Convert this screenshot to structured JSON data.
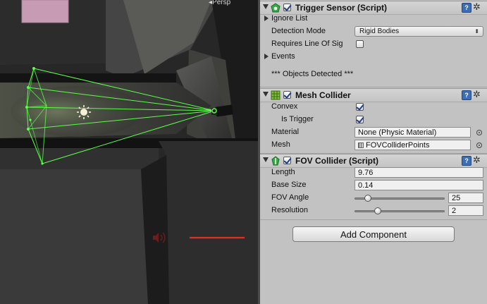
{
  "scene": {
    "camera_mode": "Persp"
  },
  "inspector": {
    "trigger_sensor": {
      "title": "Trigger Sensor (Script)",
      "ignore_list_label": "Ignore List",
      "detection_mode_label": "Detection Mode",
      "detection_mode_value": "Rigid Bodies",
      "requires_los_label": "Requires Line Of Sig",
      "requires_los_checked": false,
      "events_label": "Events",
      "objects_detected_label": "*** Objects Detected ***"
    },
    "mesh_collider": {
      "title": "Mesh Collider",
      "convex_label": "Convex",
      "convex_checked": true,
      "is_trigger_label": "Is Trigger",
      "is_trigger_checked": true,
      "material_label": "Material",
      "material_value": "None (Physic Material)",
      "mesh_label": "Mesh",
      "mesh_value": "FOVColliderPoints"
    },
    "fov_collider": {
      "title": "FOV Collider (Script)",
      "length_label": "Length",
      "length_value": "9.76",
      "base_size_label": "Base Size",
      "base_size_value": "0.14",
      "fov_angle_label": "FOV Angle",
      "fov_angle_value": "25",
      "resolution_label": "Resolution",
      "resolution_value": "2"
    },
    "add_component_label": "Add Component"
  },
  "colors": {
    "inspector_bg": "#c2c2c2",
    "header_bg": "#c8c8c8",
    "gizmo_green": "#5cff4a",
    "accent_blue": "#3d6db4"
  },
  "icons": {
    "trigger_sensor": "script-sensor-icon",
    "mesh_collider": "mesh-collider-icon",
    "fov_collider": "fov-collider-icon",
    "help": "help-book-icon",
    "settings": "gear-icon",
    "light": "point-light-icon",
    "audio": "audio-source-icon"
  }
}
